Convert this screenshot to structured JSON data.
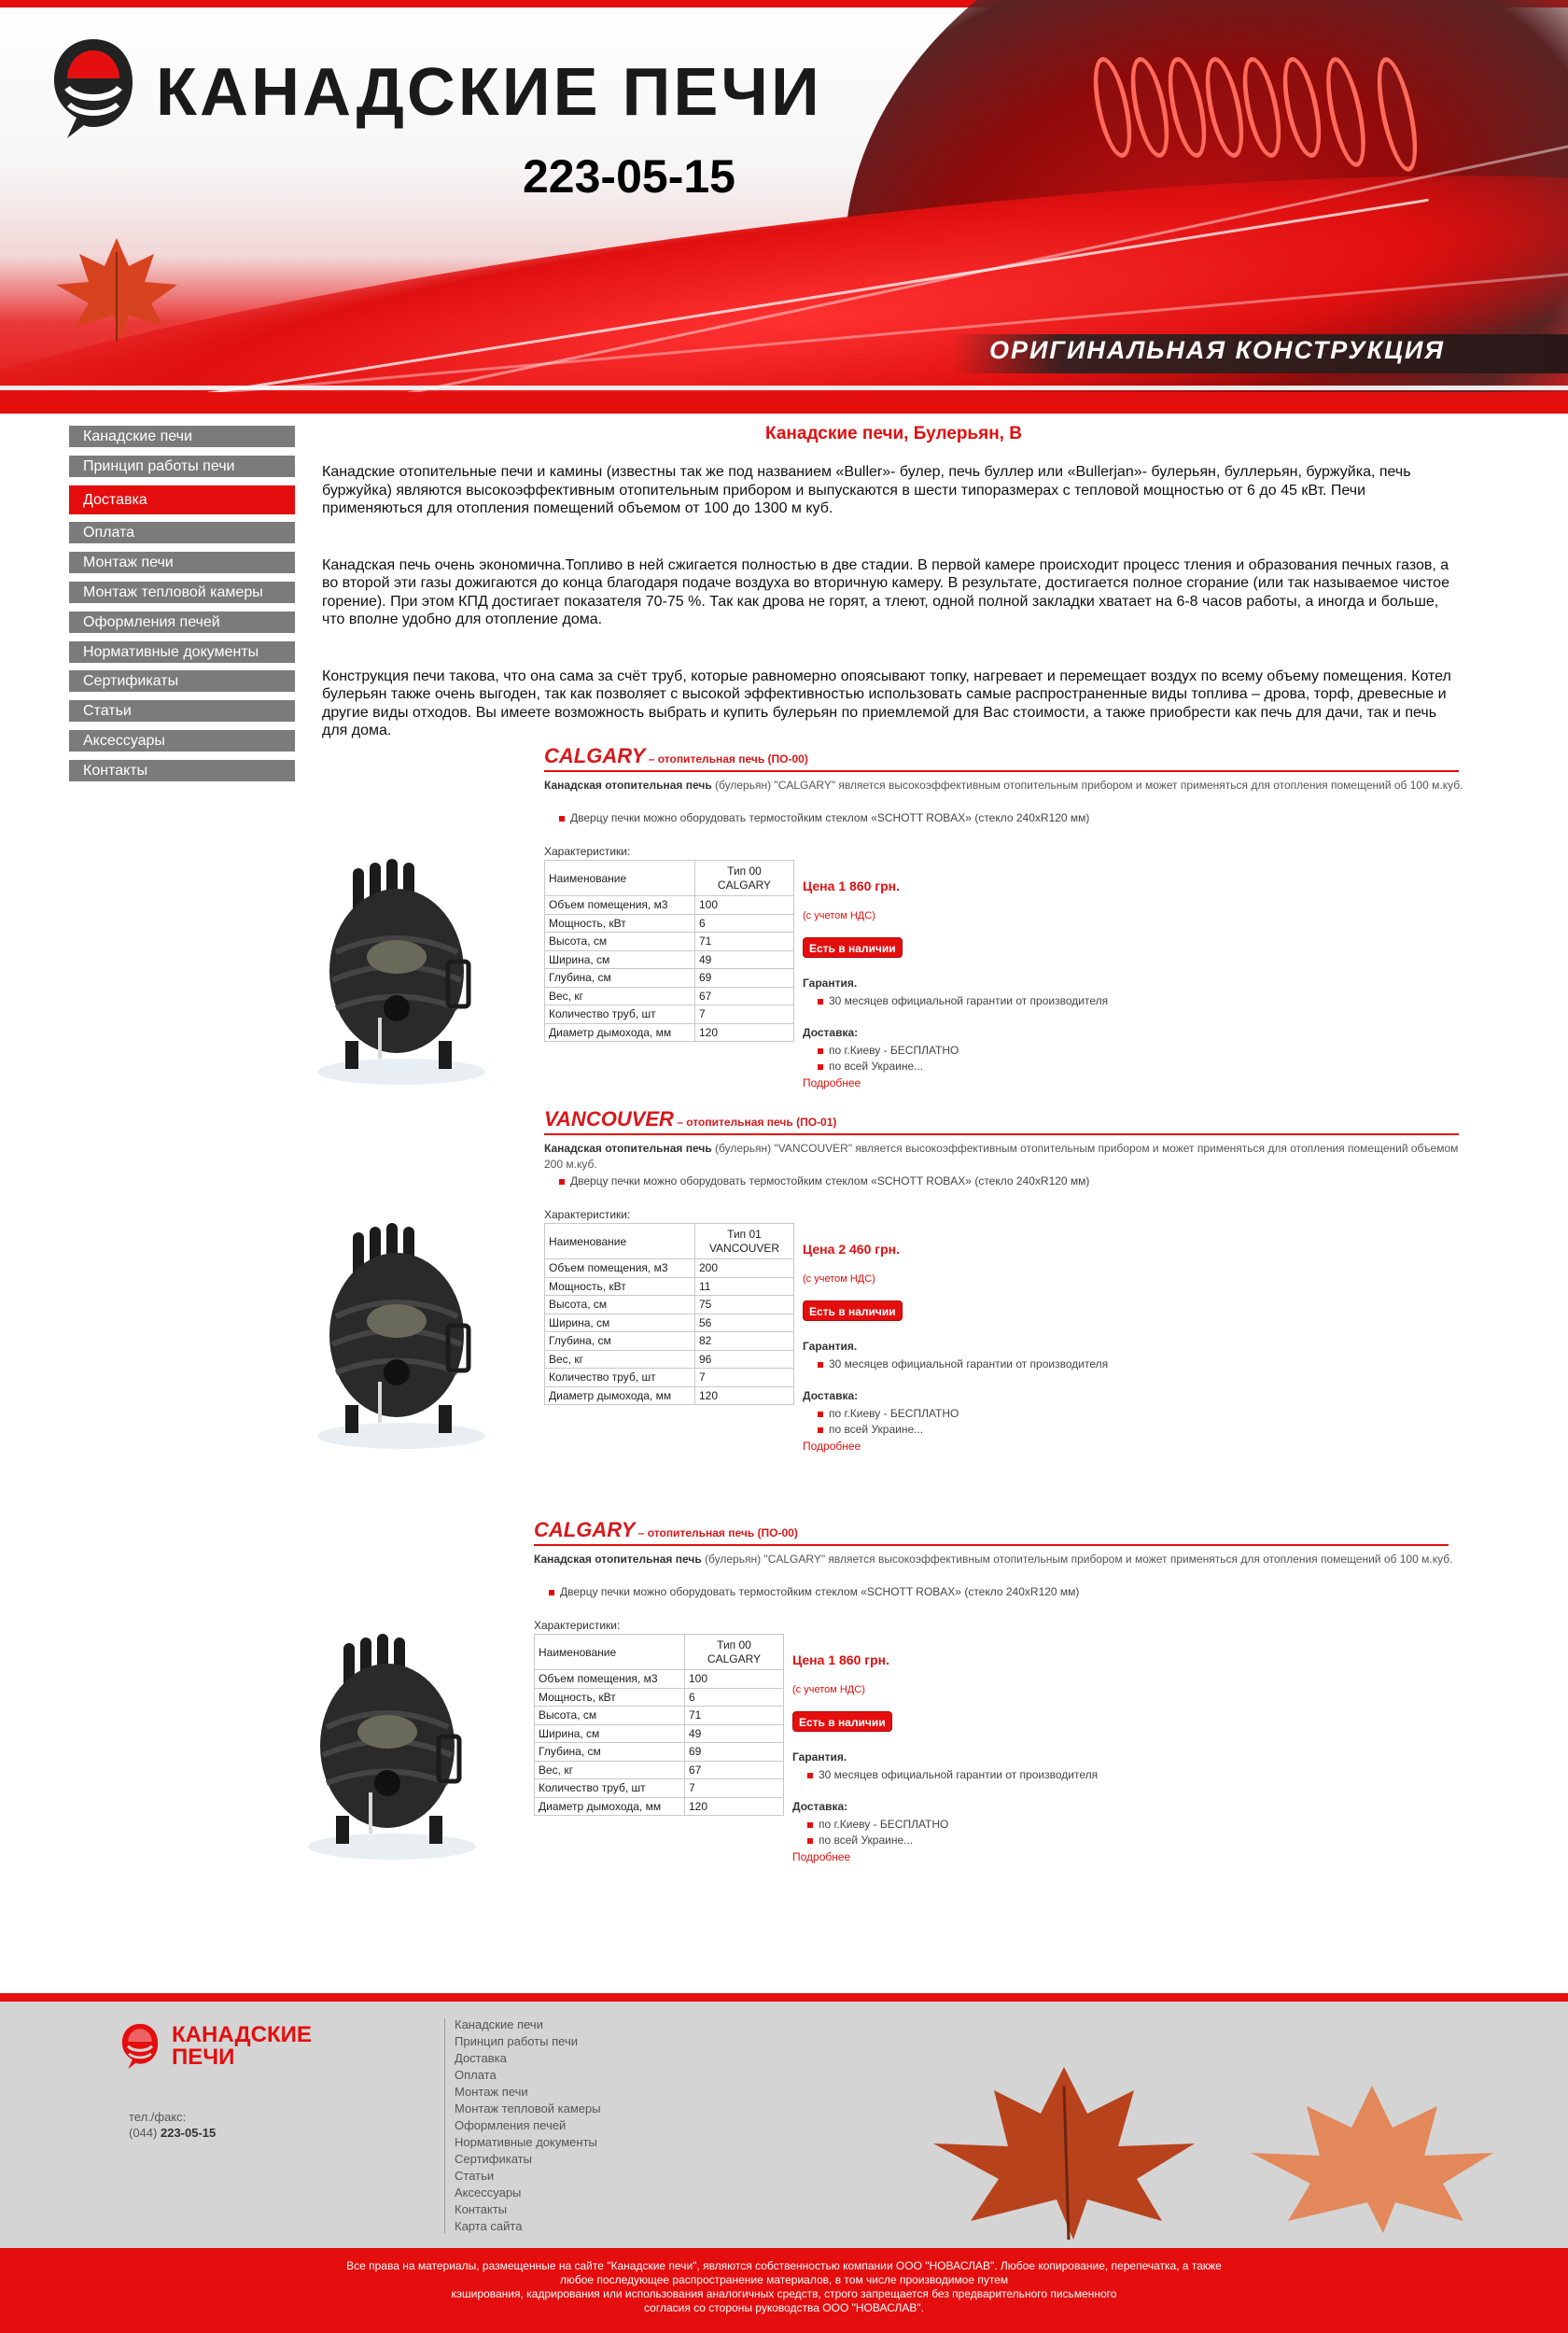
{
  "header": {
    "logo_text": "КАНАДСКИЕ ПЕЧИ",
    "phone": "223-05-15",
    "tagline": "ОРИГИНАЛЬНАЯ  КОНСТРУКЦИЯ"
  },
  "sidebar": {
    "items": [
      {
        "label": "Канадские печи",
        "active": false
      },
      {
        "label": "Принцип работы печи",
        "active": false
      },
      {
        "label": "Доставка",
        "active": true
      },
      {
        "label": "Оплата",
        "active": false
      },
      {
        "label": "Монтаж печи",
        "active": false
      },
      {
        "label": "Монтаж тепловой камеры",
        "active": false
      },
      {
        "label": "Оформления печей",
        "active": false
      },
      {
        "label": "Нормативные документы",
        "active": false
      },
      {
        "label": "Сертификаты",
        "active": false
      },
      {
        "label": "Статьи",
        "active": false
      },
      {
        "label": "Аксессуары",
        "active": false
      },
      {
        "label": "Контакты",
        "active": false
      }
    ]
  },
  "main": {
    "title": "Канадские печи, Булерьян, В",
    "paragraphs": [
      "Канадские отопительные печи и камины (известны так же под названием «Buller»- булер, печь буллер или «Bullerjan»- булерьян, буллерьян, буржуйка, печь буржуйка) являются высокоэффективным отопительным прибором и выпускаются в шести типоразмерах с тепловой мощностью от 6 до 45 кВт. Печи применяються для отопления помещений объемом от 100 до 1300 м куб.",
      "Канадская печь очень экономична.Топливо в ней сжигается полностью в две стадии. В первой камере происходит процесс тления и образования печных газов, а во второй эти газы дожигаются до конца благодаря подаче воздуха во вторичную камеру. В результате, достигается полное сгорание (или так называемое чистое горение). При этом КПД достигает показателя 70-75 %. Так как дрова не горят, а тлеют, одной полной закладки хватает на 6-8 часов работы, а иногда и больше, что вполне удобно для отопление дома.",
      "Конструкция печи такова, что она сама за счёт труб, которые равномерно опоясывают топку, нагревает и перемещает воздух по всему объему помещения. Котел булерьян также очень выгоден, так как позволяет с высокой эффективностью использовать самые распространенные виды топлива – дрова, торф, древесные и другие виды отходов. Вы имеете возможность выбрать и купить булерьян по приемлемой для Вас стоимости, а также приобрести как печь для дачи, так и печь для дома."
    ]
  },
  "products": [
    {
      "name": "CALGARY",
      "subtitle": " – отопительная печь (ПО-00)",
      "desc_bold": "Канадская отопительная печь",
      "desc_rest": " (булерьян) \"CALGARY\" является высокоэффективным отопительным прибором и может применяться для отопления помещений об 100 м.куб.",
      "bullet": "Дверцу печки можно оборудовать термостойким стеклом «SCHOTT ROBAX» (стекло 240хR120 мм)",
      "char_label": "Характеристики:",
      "table_header": [
        "Наименование",
        "Тип 00 CALGARY"
      ],
      "rows": [
        [
          "Объем помещения, м3",
          "100"
        ],
        [
          "Мощность, кВт",
          "6"
        ],
        [
          "Высота, см",
          "71"
        ],
        [
          "Ширина, см",
          "49"
        ],
        [
          "Глубина, см",
          "69"
        ],
        [
          "Вес, кг",
          "67"
        ],
        [
          "Количество труб, шт",
          "7"
        ],
        [
          "Диаметр дымохода, мм",
          "120"
        ]
      ],
      "price": "Цена 1 860 грн.",
      "vat": "(с учетом НДС)",
      "stock": "Есть в наличии",
      "warranty_label": "Гарантия.",
      "warranty": "30 месяцев официальной гарантии от производителя",
      "delivery_label": "Доставка:",
      "delivery": [
        "по г.Киеву - БЕСПЛАТНО",
        "по всей Украине..."
      ],
      "more": "Подробнее"
    },
    {
      "name": "VANCOUVER",
      "subtitle": " – отопительная печь (ПО-01)",
      "desc_bold": "Канадская отопительная печь",
      "desc_rest": " (булерьян) \"VANCOUVER\" является высокоэффективным отопительным прибором и может применяться для отопления помещений объемом 200 м.куб.",
      "bullet": "Дверцу печки можно оборудовать термостойким стеклом «SCHOTT ROBAX» (стекло 240хR120 мм)",
      "char_label": "Характеристики:",
      "table_header": [
        "Наименование",
        "Тип 01 VANCOUVER"
      ],
      "rows": [
        [
          "Объем помещения, м3",
          "200"
        ],
        [
          "Мощность, кВт",
          "11"
        ],
        [
          "Высота, см",
          "75"
        ],
        [
          "Ширина, см",
          "56"
        ],
        [
          "Глубина, см",
          "82"
        ],
        [
          "Вес, кг",
          "96"
        ],
        [
          "Количество труб, шт",
          "7"
        ],
        [
          "Диаметр дымохода, мм",
          "120"
        ]
      ],
      "price": "Цена 2 460 грн.",
      "vat": "(с учетом НДС)",
      "stock": "Есть в наличии",
      "warranty_label": "Гарантия.",
      "warranty": "30 месяцев официальной гарантии от производителя",
      "delivery_label": "Доставка:",
      "delivery": [
        "по г.Киеву - БЕСПЛАТНО",
        "по всей Украине..."
      ],
      "more": "Подробнее"
    },
    {
      "name": "CALGARY",
      "subtitle": " – отопительная печь (ПО-00)",
      "desc_bold": "Канадская отопительная печь",
      "desc_rest": " (булерьян) \"CALGARY\" является высокоэффективным отопительным прибором и может применяться для отопления помещений об 100 м.куб.",
      "bullet": "Дверцу печки можно оборудовать термостойким стеклом «SCHOTT ROBAX» (стекло 240хR120 мм)",
      "char_label": "Характеристики:",
      "table_header": [
        "Наименование",
        "Тип 00 CALGARY"
      ],
      "rows": [
        [
          "Объем помещения, м3",
          "100"
        ],
        [
          "Мощность, кВт",
          "6"
        ],
        [
          "Высота, см",
          "71"
        ],
        [
          "Ширина, см",
          "49"
        ],
        [
          "Глубина, см",
          "69"
        ],
        [
          "Вес, кг",
          "67"
        ],
        [
          "Количество труб, шт",
          "7"
        ],
        [
          "Диаметр дымохода, мм",
          "120"
        ]
      ],
      "price": "Цена 1 860 грн.",
      "vat": "(с учетом НДС)",
      "stock": "Есть в наличии",
      "warranty_label": "Гарантия.",
      "warranty": "30 месяцев официальной гарантии от производителя",
      "delivery_label": "Доставка:",
      "delivery": [
        "по г.Киеву - БЕСПЛАТНО",
        "по всей Украине..."
      ],
      "more": "Подробнее"
    }
  ],
  "footer": {
    "logo_line1": "КАНАДСКИЕ",
    "logo_line2": "ПЕЧИ",
    "phone_label": "тел./факс:",
    "phone_code": "(044)",
    "phone": "223-05-15",
    "links": [
      "Канадские печи",
      "Принцип работы печи",
      "Доставка",
      "Оплата",
      "Монтаж печи",
      "Монтаж тепловой камеры",
      "Оформления печей",
      "Нормативные документы",
      "Сертификаты",
      "Статьи",
      "Аксессуары",
      "Контакты",
      "Карта сайта"
    ],
    "copyright": [
      "Все права на материалы, размещенные на сайте \"Канадские печи\", являются собственностью компании ООО \"НОВАСЛАВ\". Любое копирование, перепечатка, а также",
      "любое последующее распространение материалов, в том числе производимое путем",
      "кэширования, кадрирования или использования аналогичных средств, строго запрещается без предварительного письменного",
      "согласия со стороны руководства ООО \"НОВАСЛАВ\"."
    ]
  },
  "colors": {
    "accent": "#e40e0e",
    "nav": "#7b7b7b",
    "footer_bg": "#d4d4d4"
  }
}
